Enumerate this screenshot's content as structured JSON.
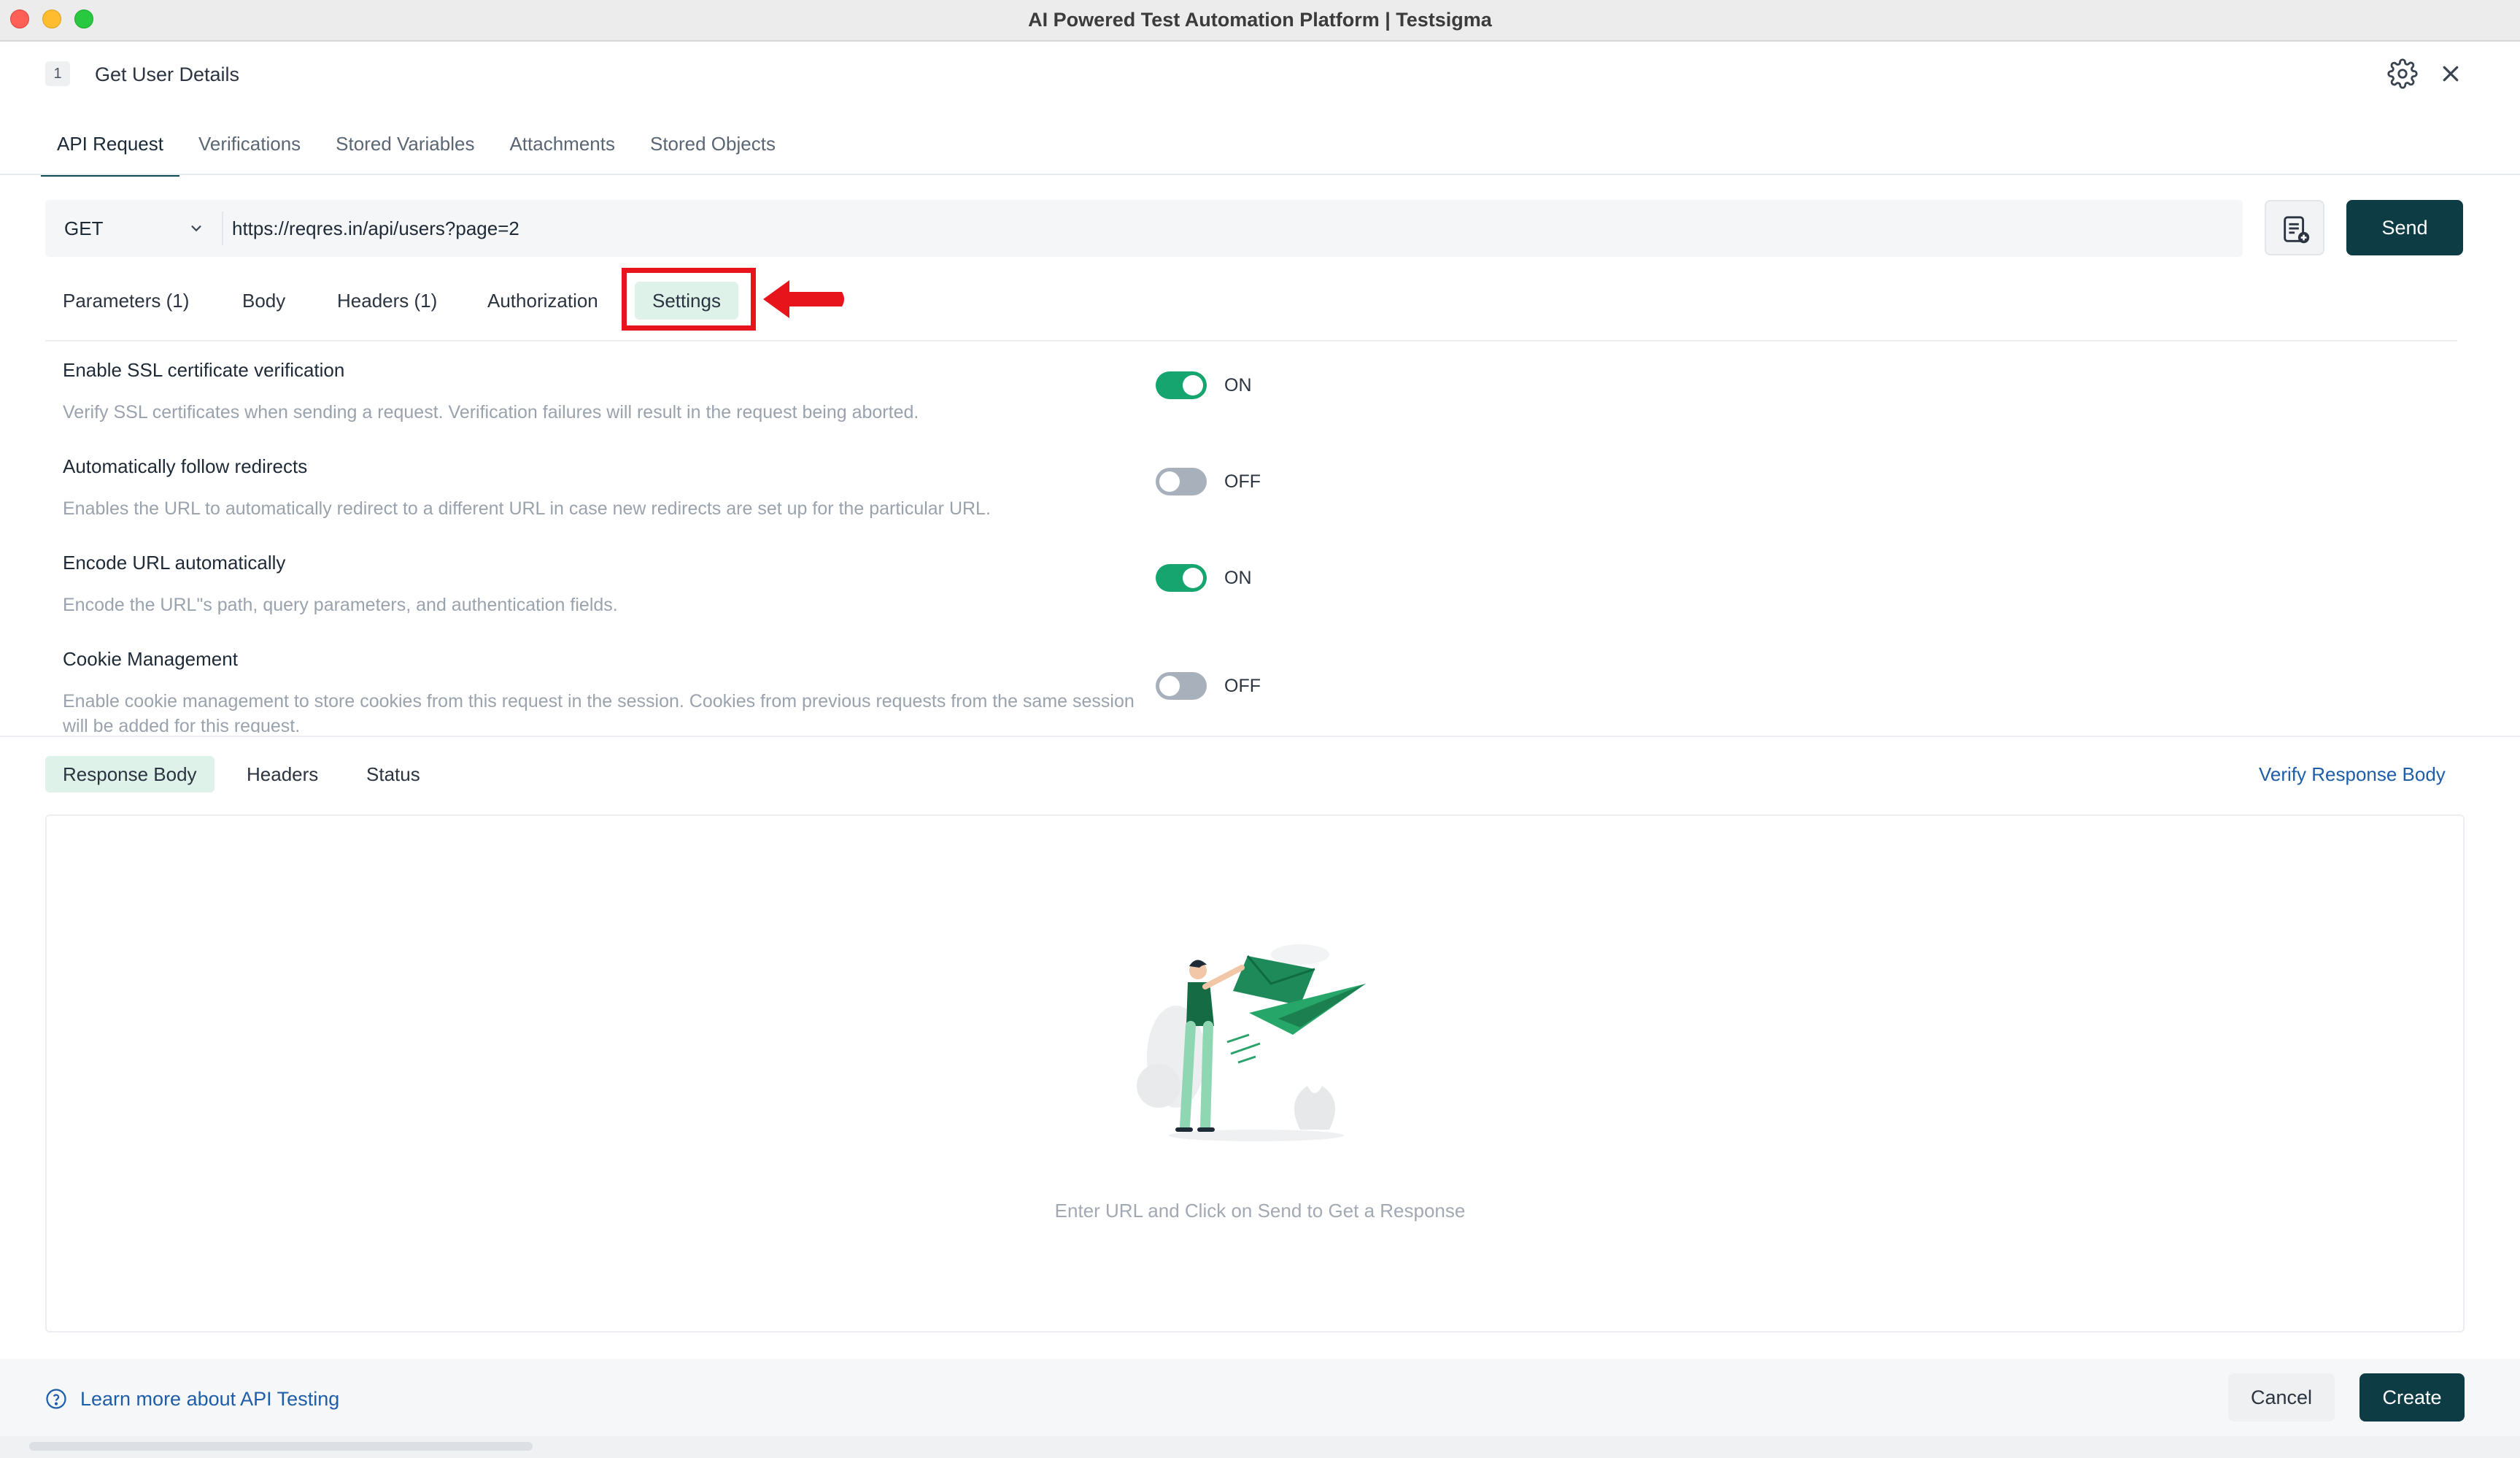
{
  "window": {
    "title": "AI Powered Test Automation Platform | Testsigma"
  },
  "header": {
    "step_number": "1",
    "step_title": "Get User Details"
  },
  "top_tabs": [
    {
      "label": "API Request",
      "active": true
    },
    {
      "label": "Verifications",
      "active": false
    },
    {
      "label": "Stored Variables",
      "active": false
    },
    {
      "label": "Attachments",
      "active": false
    },
    {
      "label": "Stored Objects",
      "active": false
    }
  ],
  "request": {
    "method": "GET",
    "url": "https://reqres.in/api/users?page=2",
    "send_label": "Send"
  },
  "request_tabs": [
    {
      "label": "Parameters (1)",
      "active": false
    },
    {
      "label": "Body",
      "active": false
    },
    {
      "label": "Headers (1)",
      "active": false
    },
    {
      "label": "Authorization",
      "active": false
    },
    {
      "label": "Settings",
      "active": true
    }
  ],
  "settings": [
    {
      "title": "Enable SSL certificate verification",
      "description": "Verify SSL certificates when sending a request. Verification failures will result in the request being aborted.",
      "enabled": true,
      "state_label": "ON"
    },
    {
      "title": "Automatically follow redirects",
      "description": "Enables the URL to automatically redirect to a different URL in case new redirects are set up for the particular URL.",
      "enabled": false,
      "state_label": "OFF"
    },
    {
      "title": "Encode URL automatically",
      "description": "Encode the URL\"s path, query parameters, and authentication fields.",
      "enabled": true,
      "state_label": "ON"
    },
    {
      "title": "Cookie Management",
      "description": "Enable cookie management to store cookies from this request in the session. Cookies from previous requests from the same session will be added for this request.",
      "enabled": false,
      "state_label": "OFF"
    }
  ],
  "response": {
    "tabs": [
      {
        "label": "Response Body",
        "active": true
      },
      {
        "label": "Headers",
        "active": false
      },
      {
        "label": "Status",
        "active": false
      }
    ],
    "verify_link": "Verify Response Body",
    "empty_message": "Enter URL and Click on Send to Get a Response"
  },
  "footer": {
    "help_link": "Learn more about API Testing",
    "cancel_label": "Cancel",
    "create_label": "Create"
  },
  "colors": {
    "accent_dark": "#0e3c45",
    "toggle_on": "#16a56e",
    "toggle_off": "#a8b0bb",
    "active_tab_bg": "#dff2ea",
    "annotation_red": "#e8141b",
    "link_blue": "#1e5ea8"
  }
}
